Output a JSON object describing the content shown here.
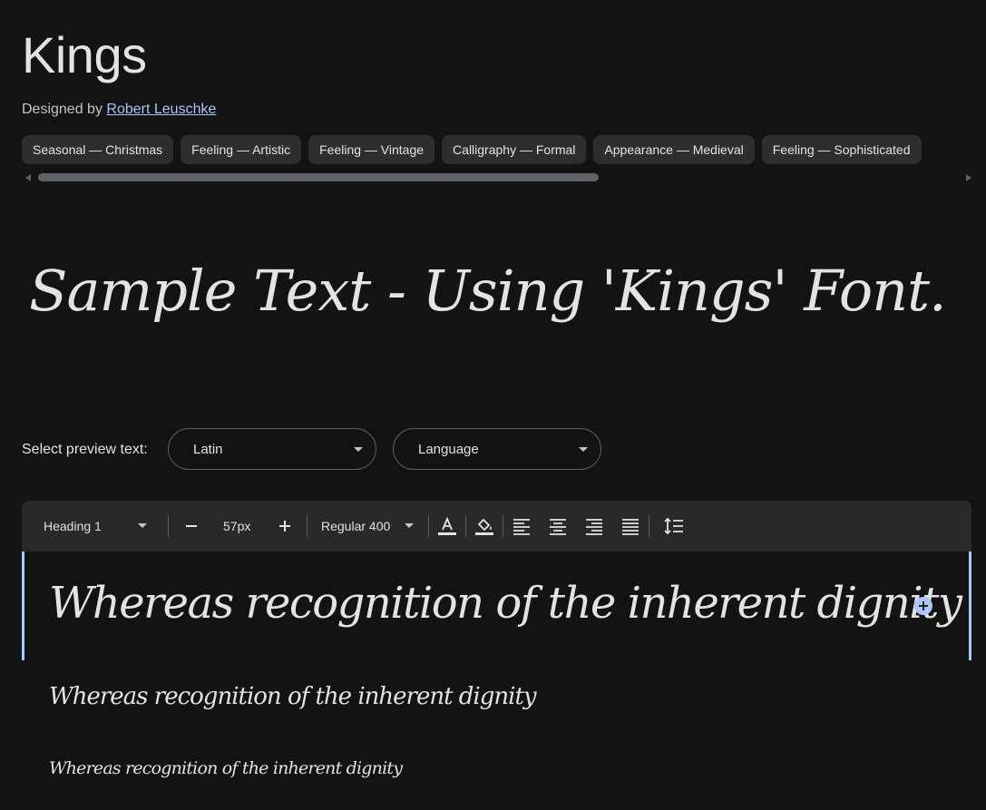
{
  "header": {
    "title": "Kings",
    "designed_by_label": "Designed by",
    "designer_name": "Robert Leuschke"
  },
  "tags": [
    "Seasonal — Christmas",
    "Feeling — Artistic",
    "Feeling — Vintage",
    "Calligraphy — Formal",
    "Appearance — Medieval",
    "Feeling — Sophisticated"
  ],
  "sample": {
    "text": "Sample Text - Using 'Kings' Font."
  },
  "preview_controls": {
    "label": "Select preview text:",
    "script_select": "Latin",
    "language_select": "Language"
  },
  "toolbar": {
    "style": "Heading 1",
    "font_size": "57px",
    "weight": "Regular 400"
  },
  "preview": {
    "lines": [
      "Whereas recognition of the inherent dignity",
      "Whereas recognition of the inherent dignity",
      "Whereas recognition of the inherent dignity"
    ]
  },
  "icons": [
    "chevron-left-icon",
    "chevron-right-icon",
    "minus-icon",
    "plus-icon",
    "text-color-icon",
    "fill-color-icon",
    "align-left-icon",
    "align-center-icon",
    "align-right-icon",
    "align-justify-icon",
    "line-height-icon",
    "add-circle-icon"
  ],
  "colors": {
    "background": "#131314",
    "surface": "#28292a",
    "chip": "#2d2e30",
    "accent": "#a8c7fa",
    "text": "#e3e3e3"
  }
}
